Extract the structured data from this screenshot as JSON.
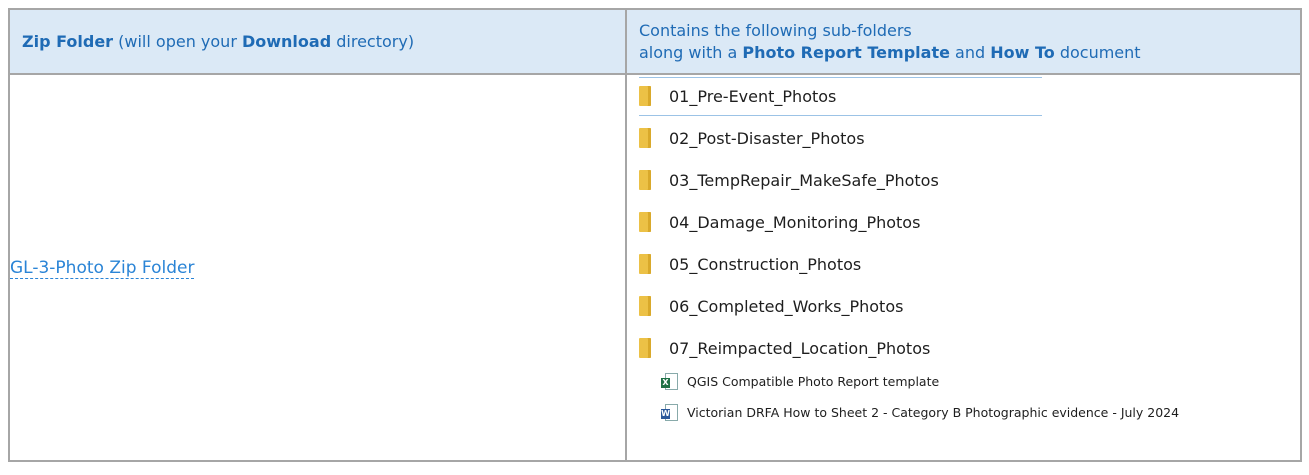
{
  "header": {
    "left": {
      "bold1": "Zip Folder",
      "text1": " (will open your ",
      "bold2": "Download",
      "text2": " directory)"
    },
    "right": {
      "line1": "Contains the following sub-folders",
      "text1": "along with a ",
      "bold1": "Photo Report Template",
      "text2": " and ",
      "bold2": "How To",
      "text3": " document"
    }
  },
  "zip_link": "GL-3-Photo Zip Folder",
  "folders": [
    {
      "label": "01_Pre-Event_Photos",
      "icon": "folder-icon"
    },
    {
      "label": "02_Post-Disaster_Photos",
      "icon": "folder-icon"
    },
    {
      "label": "03_TempRepair_MakeSafe_Photos",
      "icon": "folder-icon"
    },
    {
      "label": "04_Damage_Monitoring_Photos",
      "icon": "folder-icon"
    },
    {
      "label": "05_Construction_Photos",
      "icon": "folder-icon"
    },
    {
      "label": "06_Completed_Works_Photos",
      "icon": "folder-icon"
    },
    {
      "label": "07_Reimpacted_Location_Photos",
      "icon": "folder-icon"
    }
  ],
  "documents": [
    {
      "label": "QGIS Compatible Photo Report template",
      "icon": "excel-icon",
      "badge": "X"
    },
    {
      "label": "Victorian DRFA How to Sheet 2 - Category B Photographic evidence - July 2024",
      "icon": "word-icon",
      "badge": "W"
    }
  ],
  "colors": {
    "header_bg": "#dbe9f6",
    "header_text": "#1f6bb5",
    "link": "#2a84d6",
    "folder": "#ecc146"
  }
}
